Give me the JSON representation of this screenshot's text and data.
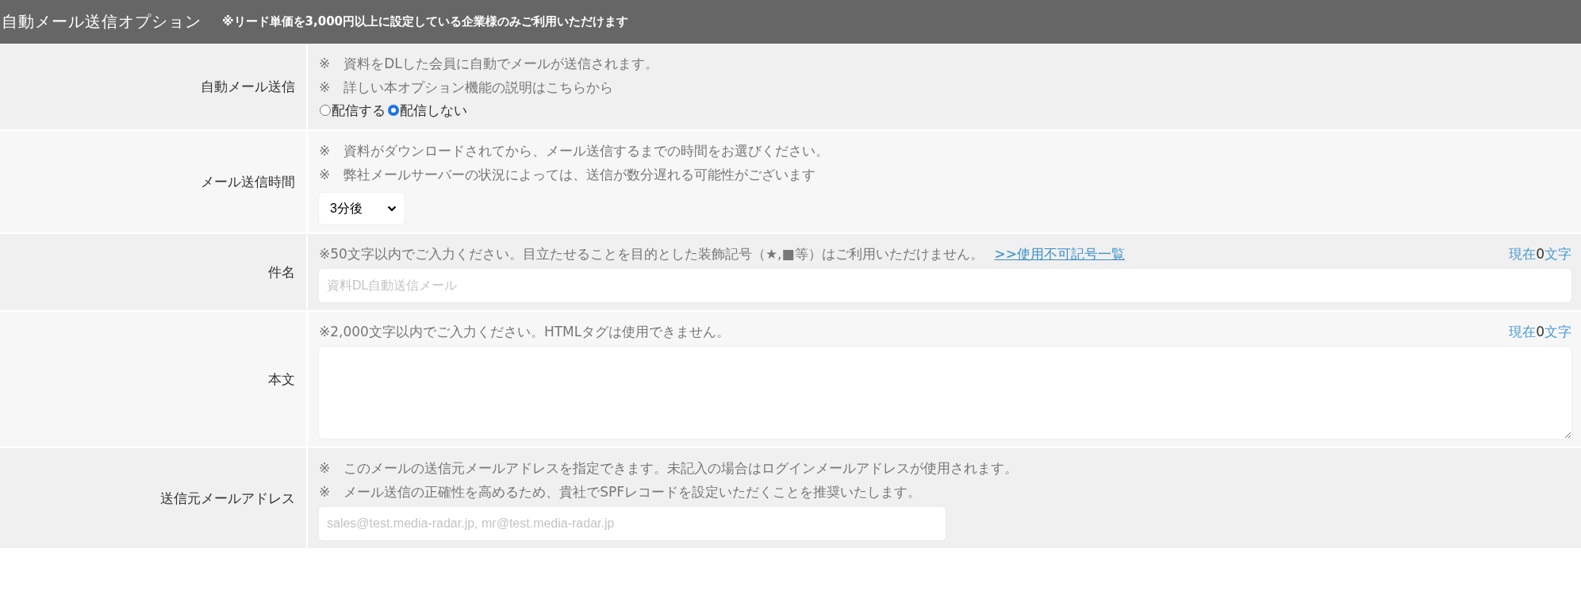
{
  "header": {
    "title": "自動メール送信オプション",
    "note": "※リード単価を3,000円以上に設定している企業様のみご利用いただけます"
  },
  "rows": [
    {
      "kind": "radio",
      "label": "自動メール送信",
      "notes": [
        "※　資料をDLした会員に自動でメールが送信されます。",
        "※　詳しい本オプション機能の説明はこちらから"
      ],
      "options": [
        {
          "label": "配信する",
          "selected": false
        },
        {
          "label": "配信しない",
          "selected": true
        }
      ]
    },
    {
      "kind": "select",
      "label": "メール送信時間",
      "notes": [
        "※　資料がダウンロードされてから、メール送信するまでの時間をお選びください。",
        "※　弊社メールサーバーの状況によっては、送信が数分遅れる可能性がございます"
      ],
      "value": "3分後"
    },
    {
      "kind": "input",
      "label": "件名",
      "notes": [
        "※50文字以内でご入力ください。目立たせることを目的とした装飾記号（★,■等）はご利用いただけません。"
      ],
      "link": ">>使用不可記号一覧",
      "counter": {
        "before": "現在",
        "count": "0",
        "after": "文字"
      },
      "placeholder": "資料DL自動送信メール"
    },
    {
      "kind": "textarea",
      "label": "本文",
      "notes": [
        "※2,000文字以内でご入力ください。HTMLタグは使用できません。"
      ],
      "counter": {
        "before": "現在",
        "count": "0",
        "after": "文字"
      }
    },
    {
      "kind": "short-input",
      "label": "送信元メールアドレス",
      "notes": [
        "※　このメールの送信元メールアドレスを指定できます。未記入の場合はログインメールアドレスが使用されます。",
        "※　メール送信の正確性を高めるため、貴社でSPFレコードを設定いただくことを推奨いたします。"
      ],
      "placeholder": "sales@test.media-radar.jp, mr@test.media-radar.jp"
    }
  ]
}
